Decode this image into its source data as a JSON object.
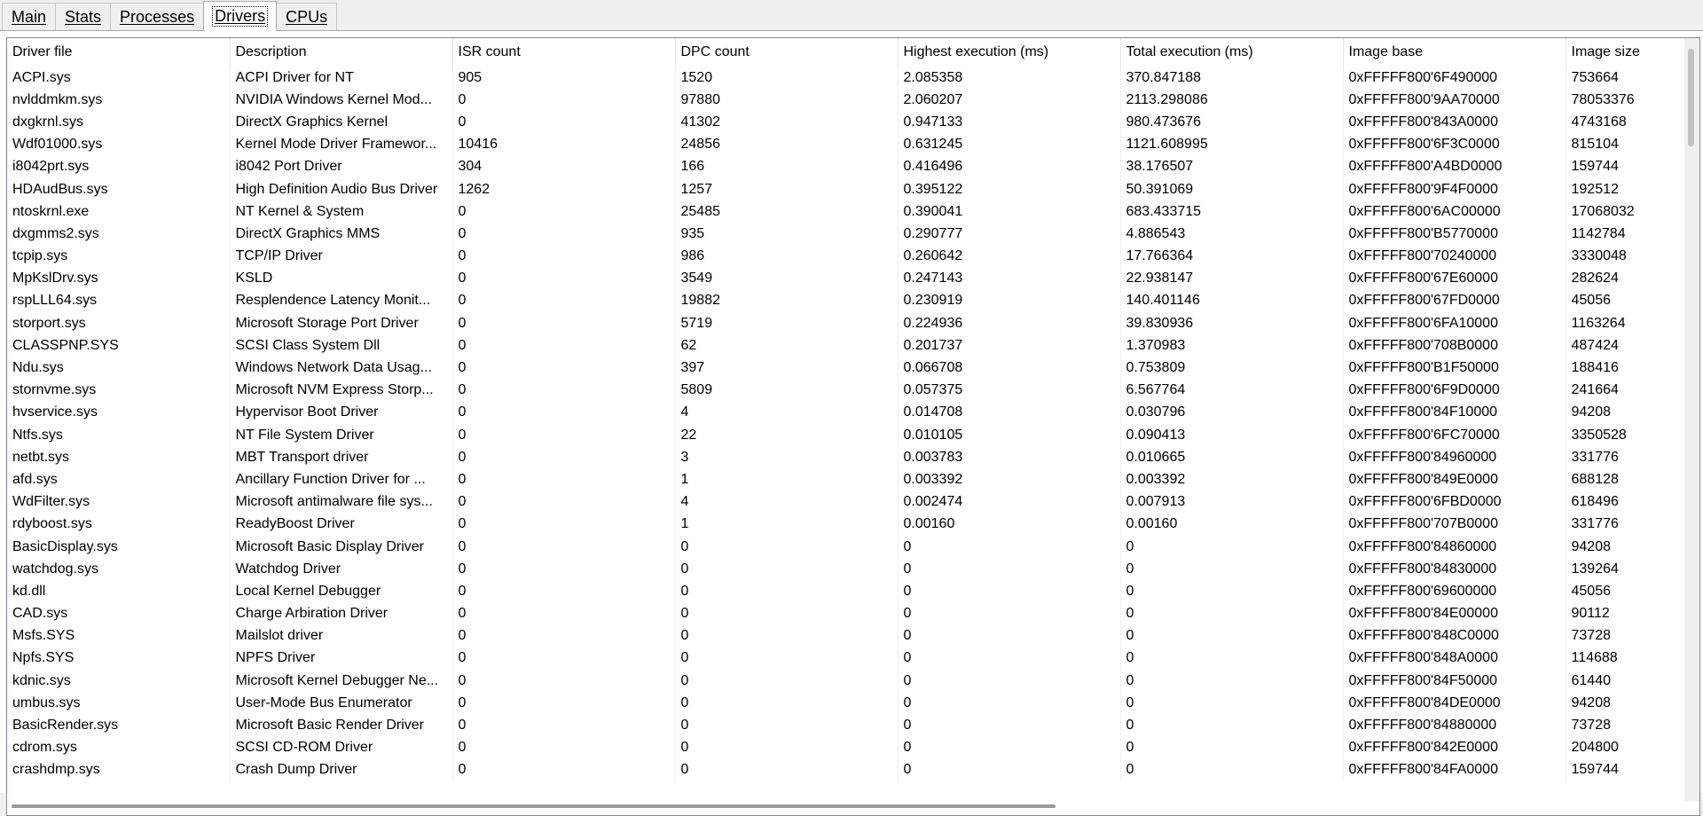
{
  "tabs": [
    {
      "label": "Main",
      "active": false
    },
    {
      "label": "Stats",
      "active": false
    },
    {
      "label": "Processes",
      "active": false
    },
    {
      "label": "Drivers",
      "active": true
    },
    {
      "label": "CPUs",
      "active": false
    }
  ],
  "table": {
    "columns": [
      "Driver file",
      "Description",
      "ISR count",
      "DPC count",
      "Highest execution (ms)",
      "Total execution (ms)",
      "Image base",
      "Image size"
    ],
    "rows": [
      [
        "ACPI.sys",
        "ACPI Driver for NT",
        "905",
        "1520",
        "2.085358",
        "370.847188",
        "0xFFFFF800'6F490000",
        "753664"
      ],
      [
        "nvlddmkm.sys",
        "NVIDIA Windows Kernel Mod...",
        "0",
        "97880",
        "2.060207",
        "2113.298086",
        "0xFFFFF800'9AA70000",
        "78053376"
      ],
      [
        "dxgkrnl.sys",
        "DirectX Graphics Kernel",
        "0",
        "41302",
        "0.947133",
        "980.473676",
        "0xFFFFF800'843A0000",
        "4743168"
      ],
      [
        "Wdf01000.sys",
        "Kernel Mode Driver Framewor...",
        "10416",
        "24856",
        "0.631245",
        "1121.608995",
        "0xFFFFF800'6F3C0000",
        "815104"
      ],
      [
        "i8042prt.sys",
        "i8042 Port Driver",
        "304",
        "166",
        "0.416496",
        "38.176507",
        "0xFFFFF800'A4BD0000",
        "159744"
      ],
      [
        "HDAudBus.sys",
        "High Definition Audio Bus Driver",
        "1262",
        "1257",
        "0.395122",
        "50.391069",
        "0xFFFFF800'9F4F0000",
        "192512"
      ],
      [
        "ntoskrnl.exe",
        "NT Kernel & System",
        "0",
        "25485",
        "0.390041",
        "683.433715",
        "0xFFFFF800'6AC00000",
        "17068032"
      ],
      [
        "dxgmms2.sys",
        "DirectX Graphics MMS",
        "0",
        "935",
        "0.290777",
        "4.886543",
        "0xFFFFF800'B5770000",
        "1142784"
      ],
      [
        "tcpip.sys",
        "TCP/IP Driver",
        "0",
        "986",
        "0.260642",
        "17.766364",
        "0xFFFFF800'70240000",
        "3330048"
      ],
      [
        "MpKslDrv.sys",
        "KSLD",
        "0",
        "3549",
        "0.247143",
        "22.938147",
        "0xFFFFF800'67E60000",
        "282624"
      ],
      [
        "rspLLL64.sys",
        "Resplendence Latency Monit...",
        "0",
        "19882",
        "0.230919",
        "140.401146",
        "0xFFFFF800'67FD0000",
        "45056"
      ],
      [
        "storport.sys",
        "Microsoft Storage Port Driver",
        "0",
        "5719",
        "0.224936",
        "39.830936",
        "0xFFFFF800'6FA10000",
        "1163264"
      ],
      [
        "CLASSPNP.SYS",
        "SCSI Class System Dll",
        "0",
        "62",
        "0.201737",
        "1.370983",
        "0xFFFFF800'708B0000",
        "487424"
      ],
      [
        "Ndu.sys",
        "Windows Network Data Usag...",
        "0",
        "397",
        "0.066708",
        "0.753809",
        "0xFFFFF800'B1F50000",
        "188416"
      ],
      [
        "stornvme.sys",
        "Microsoft NVM Express Storp...",
        "0",
        "5809",
        "0.057375",
        "6.567764",
        "0xFFFFF800'6F9D0000",
        "241664"
      ],
      [
        "hvservice.sys",
        "Hypervisor Boot Driver",
        "0",
        "4",
        "0.014708",
        "0.030796",
        "0xFFFFF800'84F10000",
        "94208"
      ],
      [
        "Ntfs.sys",
        "NT File System Driver",
        "0",
        "22",
        "0.010105",
        "0.090413",
        "0xFFFFF800'6FC70000",
        "3350528"
      ],
      [
        "netbt.sys",
        "MBT Transport driver",
        "0",
        "3",
        "0.003783",
        "0.010665",
        "0xFFFFF800'84960000",
        "331776"
      ],
      [
        "afd.sys",
        "Ancillary Function Driver for ...",
        "0",
        "1",
        "0.003392",
        "0.003392",
        "0xFFFFF800'849E0000",
        "688128"
      ],
      [
        "WdFilter.sys",
        "Microsoft antimalware file sys...",
        "0",
        "4",
        "0.002474",
        "0.007913",
        "0xFFFFF800'6FBD0000",
        "618496"
      ],
      [
        "rdyboost.sys",
        "ReadyBoost Driver",
        "0",
        "1",
        "0.00160",
        "0.00160",
        "0xFFFFF800'707B0000",
        "331776"
      ],
      [
        "BasicDisplay.sys",
        "Microsoft Basic Display Driver",
        "0",
        "0",
        "0",
        "0",
        "0xFFFFF800'84860000",
        "94208"
      ],
      [
        "watchdog.sys",
        "Watchdog Driver",
        "0",
        "0",
        "0",
        "0",
        "0xFFFFF800'84830000",
        "139264"
      ],
      [
        "kd.dll",
        "Local Kernel Debugger",
        "0",
        "0",
        "0",
        "0",
        "0xFFFFF800'69600000",
        "45056"
      ],
      [
        "CAD.sys",
        "Charge Arbiration Driver",
        "0",
        "0",
        "0",
        "0",
        "0xFFFFF800'84E00000",
        "90112"
      ],
      [
        "Msfs.SYS",
        "Mailslot driver",
        "0",
        "0",
        "0",
        "0",
        "0xFFFFF800'848C0000",
        "73728"
      ],
      [
        "Npfs.SYS",
        "NPFS Driver",
        "0",
        "0",
        "0",
        "0",
        "0xFFFFF800'848A0000",
        "114688"
      ],
      [
        "kdnic.sys",
        "Microsoft Kernel Debugger Ne...",
        "0",
        "0",
        "0",
        "0",
        "0xFFFFF800'84F50000",
        "61440"
      ],
      [
        "umbus.sys",
        "User-Mode Bus Enumerator",
        "0",
        "0",
        "0",
        "0",
        "0xFFFFF800'84DE0000",
        "94208"
      ],
      [
        "BasicRender.sys",
        "Microsoft Basic Render Driver",
        "0",
        "0",
        "0",
        "0",
        "0xFFFFF800'84880000",
        "73728"
      ],
      [
        "cdrom.sys",
        "SCSI CD-ROM Driver",
        "0",
        "0",
        "0",
        "0",
        "0xFFFFF800'842E0000",
        "204800"
      ],
      [
        "crashdmp.sys",
        "Crash Dump Driver",
        "0",
        "0",
        "0",
        "0",
        "0xFFFFF800'84FA0000",
        "159744"
      ]
    ]
  }
}
